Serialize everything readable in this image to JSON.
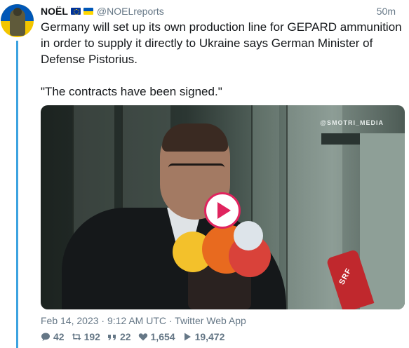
{
  "tweet": {
    "author_name": "NOËL",
    "author_flags": [
      "eu-flag-icon",
      "ukraine-flag-icon"
    ],
    "handle": "@NOELreports",
    "time_ago": "50m",
    "text_paragraphs": [
      "Germany will set up its own production line for GEPARD ammunition in order to supply it directly to Ukraine says German Minister of Defense Pistorius.",
      "\"The contracts have been signed.\""
    ],
    "media": {
      "watermark": "@SMOTRI_MEDIA",
      "mic_label": "SRF",
      "play_icon": "play-icon"
    },
    "meta_line": "Feb 14, 2023 · 9:12 AM UTC · Twitter Web App",
    "stats": {
      "replies": "42",
      "retweets": "192",
      "quotes": "22",
      "likes": "1,654",
      "views": "19,472"
    }
  },
  "colors": {
    "thread_line": "#3da3e0",
    "muted_text": "#657786",
    "play_accent": "#e0245e"
  }
}
